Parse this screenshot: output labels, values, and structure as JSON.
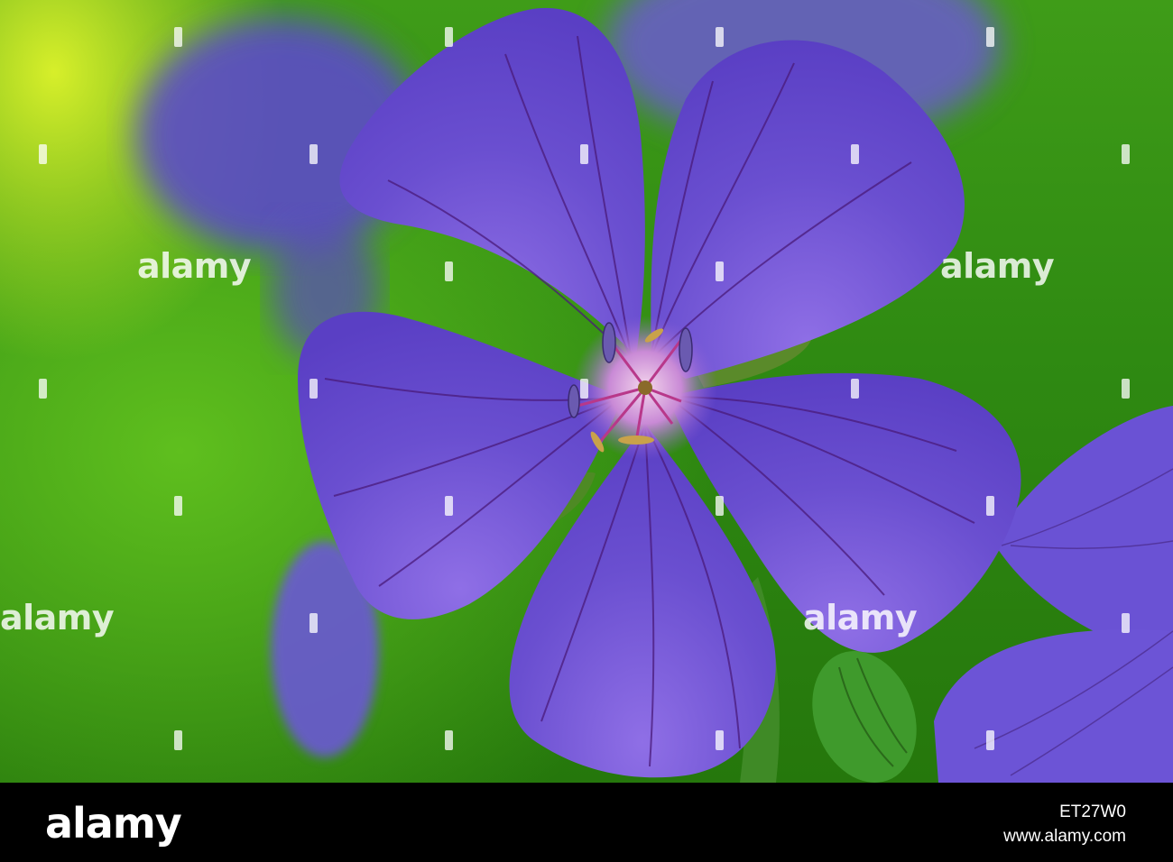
{
  "photo": {
    "subject": "purple-flower",
    "colors": {
      "background_green": "#2f8a12",
      "highlight_yellow_green": "#d7ef2a",
      "petal_violet": "#6a4fd0",
      "vein_purple": "#4a1a7a",
      "center_pink": "#d46ac0"
    }
  },
  "watermark": {
    "text": "alamy"
  },
  "footer": {
    "logo": "alamy",
    "credit_site": "www.alamy.com",
    "image_id": "ET27W0"
  }
}
